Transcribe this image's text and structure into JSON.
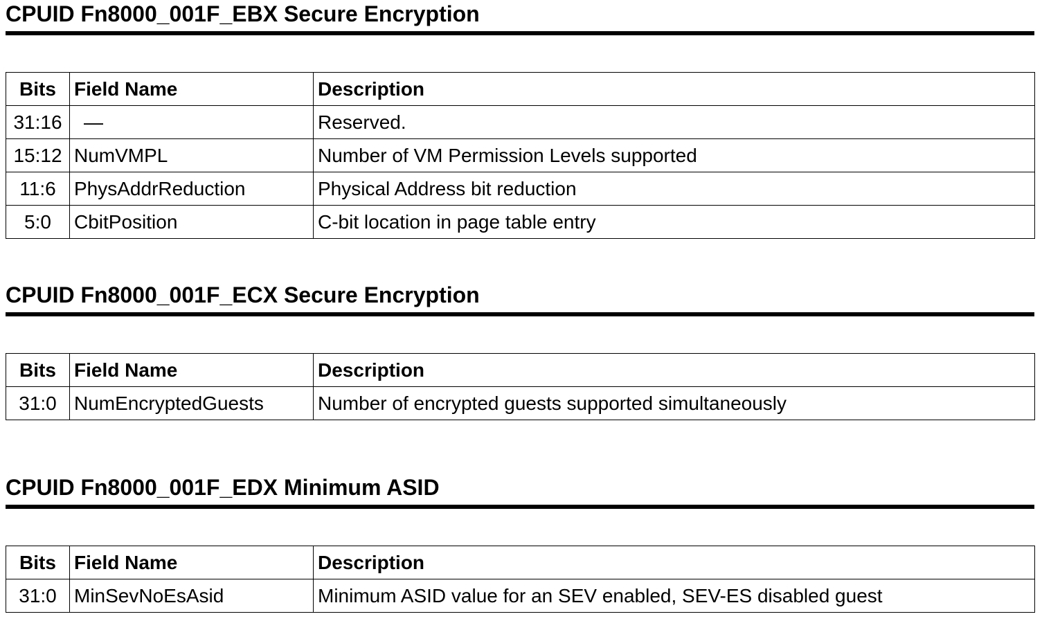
{
  "columns": {
    "bits": "Bits",
    "field": "Field Name",
    "description": "Description"
  },
  "sections": [
    {
      "title": "CPUID Fn8000_001F_EBX Secure Encryption",
      "rows": [
        {
          "bits": "31:16",
          "field": "—",
          "description": "Reserved."
        },
        {
          "bits": "15:12",
          "field": "NumVMPL",
          "description": "Number of VM Permission Levels supported"
        },
        {
          "bits": "11:6",
          "field": "PhysAddrReduction",
          "description": "Physical Address bit reduction"
        },
        {
          "bits": "5:0",
          "field": "CbitPosition",
          "description": "C-bit location in page table entry"
        }
      ]
    },
    {
      "title": "CPUID Fn8000_001F_ECX Secure Encryption",
      "rows": [
        {
          "bits": "31:0",
          "field": "NumEncryptedGuests",
          "description": "Number of encrypted guests supported simultaneously"
        }
      ]
    },
    {
      "title": "CPUID Fn8000_001F_EDX Minimum ASID",
      "rows": [
        {
          "bits": "31:0",
          "field": "MinSevNoEsAsid",
          "description": "Minimum ASID value for an SEV enabled, SEV-ES disabled guest"
        }
      ]
    }
  ]
}
